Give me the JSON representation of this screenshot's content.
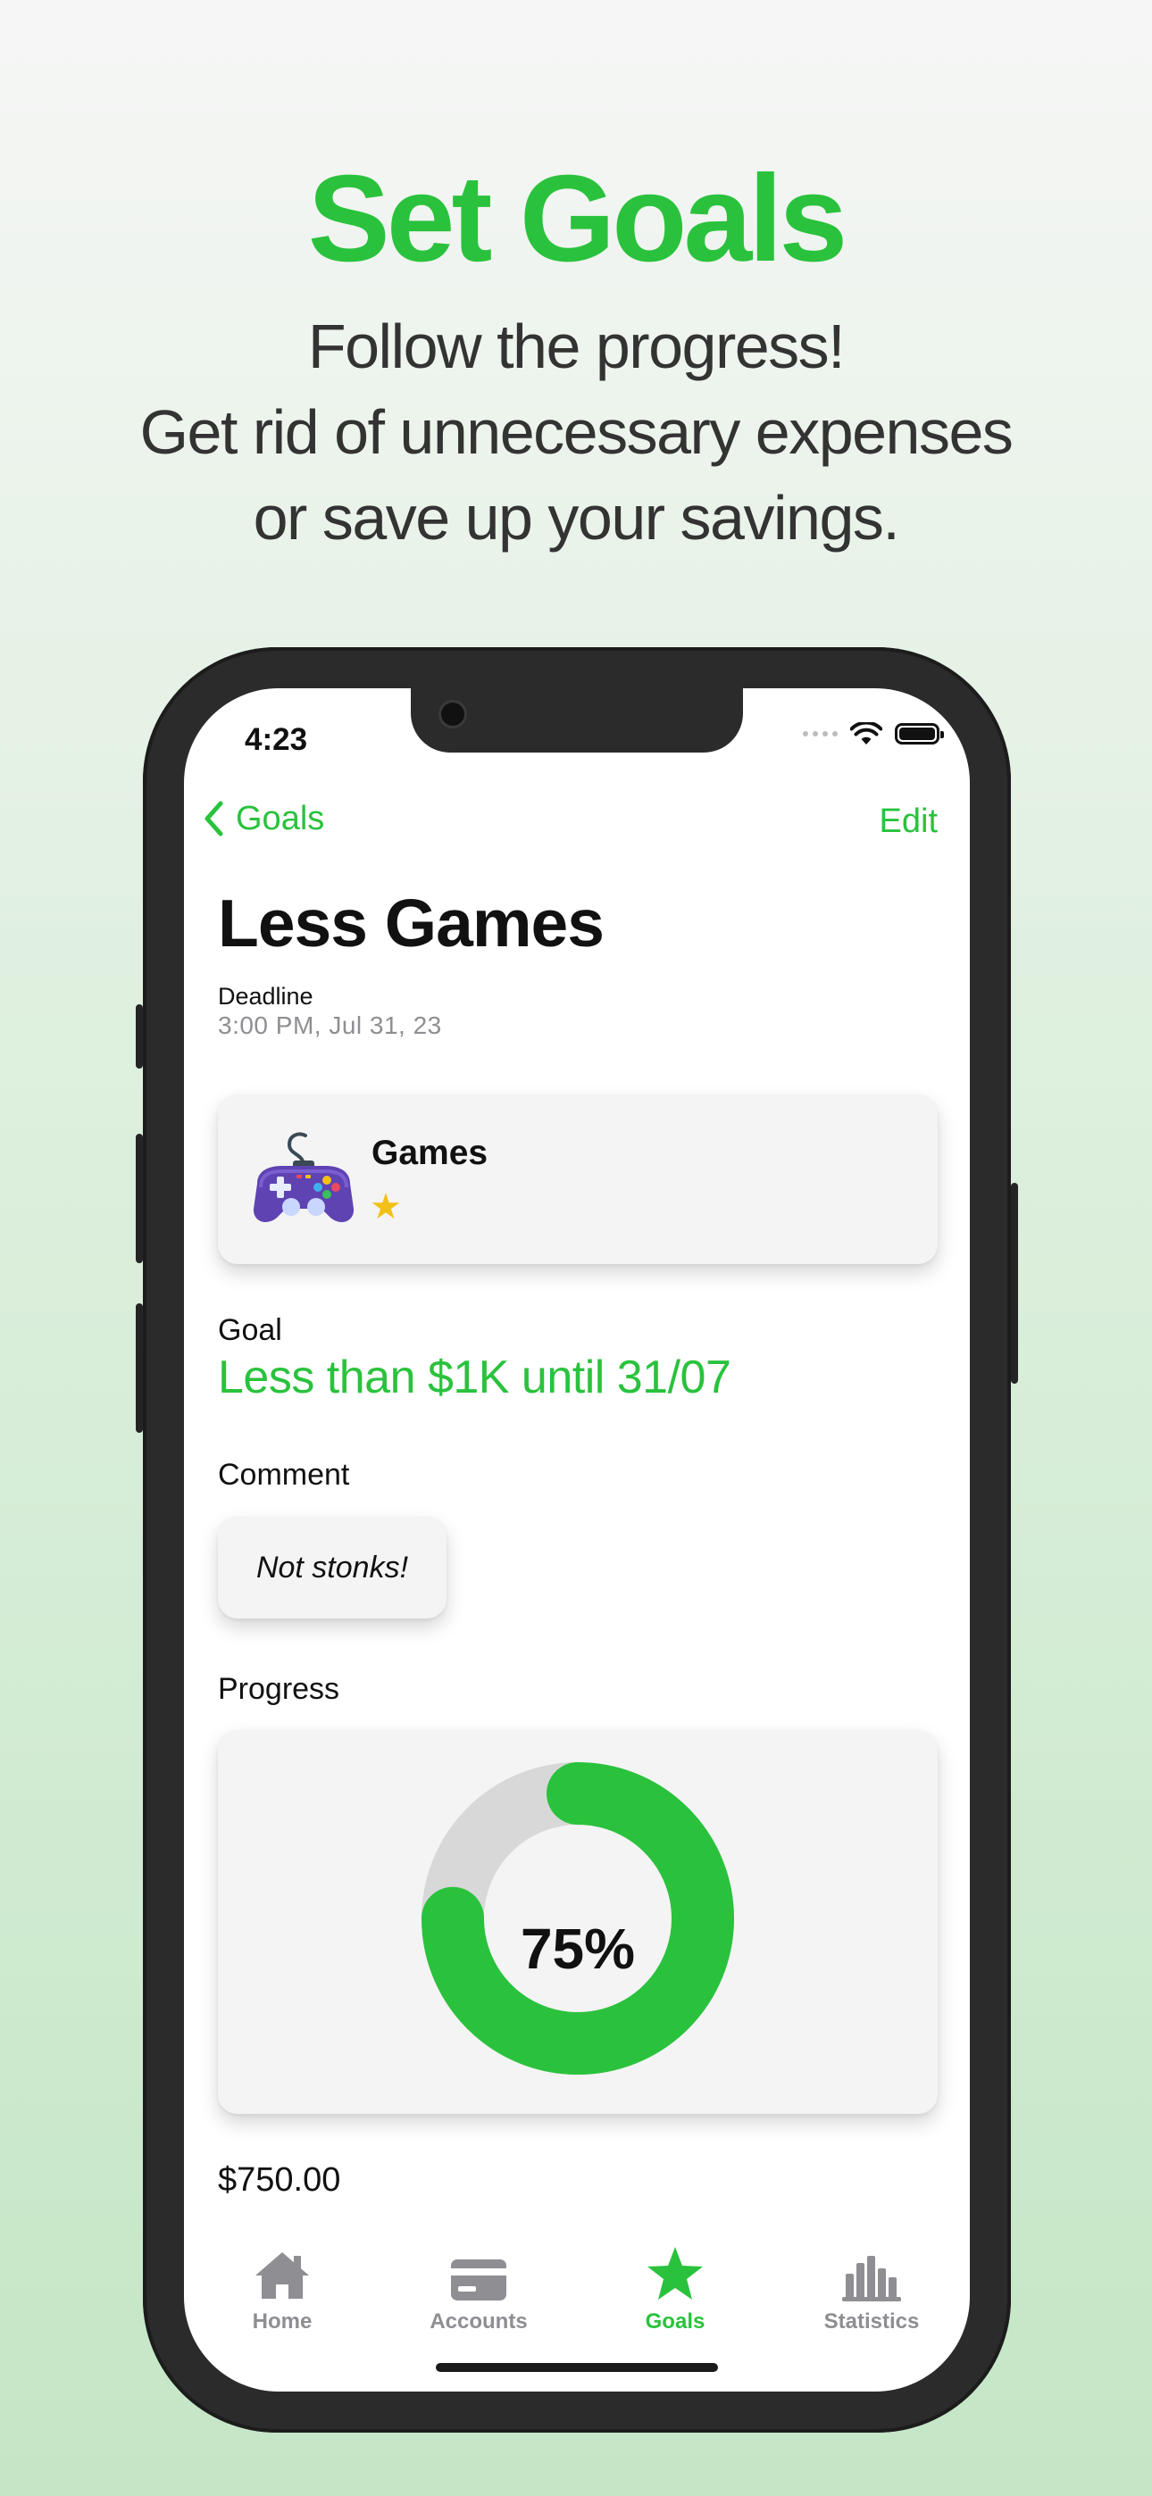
{
  "promo": {
    "title": "Set Goals",
    "subtitle_lines": [
      "Follow the progress!",
      "Get rid of unnecessary expenses",
      "or save up your savings."
    ]
  },
  "status_bar": {
    "time": "4:23"
  },
  "nav": {
    "back_label": "Goals",
    "edit_label": "Edit"
  },
  "page": {
    "title": "Less Games",
    "deadline_label": "Deadline",
    "deadline_value": "3:00 PM, Jul 31, 23"
  },
  "category": {
    "name": "Games",
    "icon": "gamepad-icon",
    "starred": true
  },
  "goal": {
    "label": "Goal",
    "value": "Less than $1K until 31/07"
  },
  "comment": {
    "label": "Comment",
    "text": "Not stonks!"
  },
  "progress": {
    "label": "Progress",
    "percent_text": "75%",
    "fraction": 0.75,
    "amount": "$750.00"
  },
  "tabs": [
    {
      "label": "Home",
      "icon": "home-icon",
      "active": false
    },
    {
      "label": "Accounts",
      "icon": "card-icon",
      "active": false
    },
    {
      "label": "Goals",
      "icon": "star-icon",
      "active": true
    },
    {
      "label": "Statistics",
      "icon": "bar-chart-icon",
      "active": false
    }
  ],
  "colors": {
    "accent": "#2ac23d",
    "track": "#d8d8d8",
    "star": "#f3c017",
    "tab_inactive": "#8e8e93"
  }
}
